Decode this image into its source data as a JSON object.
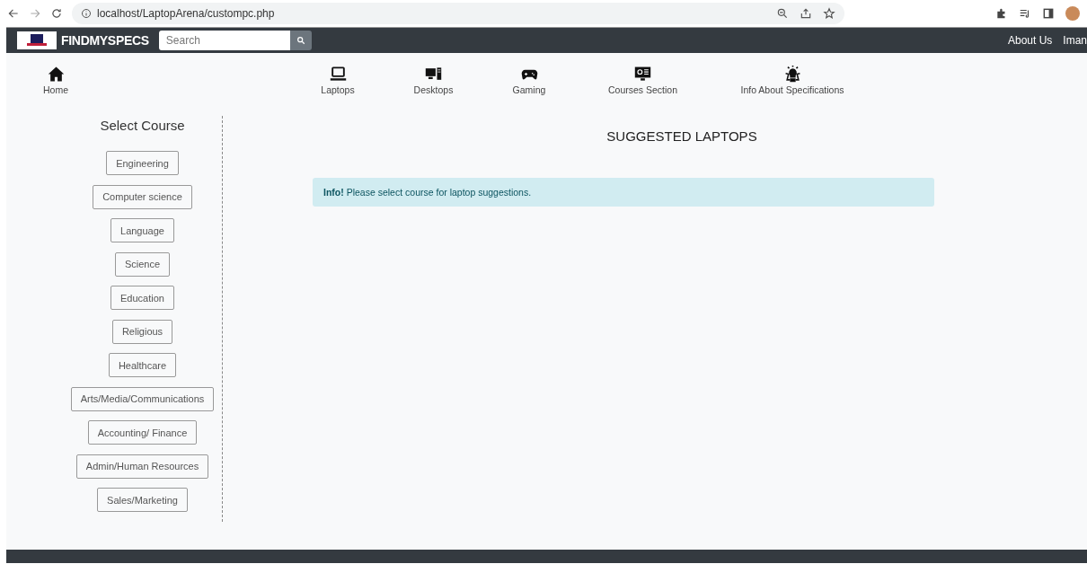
{
  "browser": {
    "url": "localhost/LaptopArena/custompc.php"
  },
  "navbar": {
    "brand": "FINDMYSPECS",
    "search": {
      "placeholder": "Search"
    },
    "links": [
      "About Us",
      "Iman"
    ]
  },
  "categories": [
    {
      "label": "Home",
      "kind": "home"
    },
    {
      "label": "Laptops",
      "kind": "laptop"
    },
    {
      "label": "Desktops",
      "kind": "desktop"
    },
    {
      "label": "Gaming",
      "kind": "gamepad"
    },
    {
      "label": "Courses Section",
      "kind": "monitor"
    },
    {
      "label": "Info About Specifications",
      "kind": "bulb"
    }
  ],
  "sidebar": {
    "title": "Select Course",
    "courses": [
      "Engineering",
      "Computer science",
      "Language",
      "Science",
      "Education",
      "Religious",
      "Healthcare",
      "Arts/Media/Communications",
      "Accounting/ Finance",
      "Admin/Human Resources",
      "Sales/Marketing"
    ]
  },
  "main": {
    "title": "SUGGESTED LAPTOPS",
    "alert": "**Info!** Please select course for laptop suggestions."
  }
}
